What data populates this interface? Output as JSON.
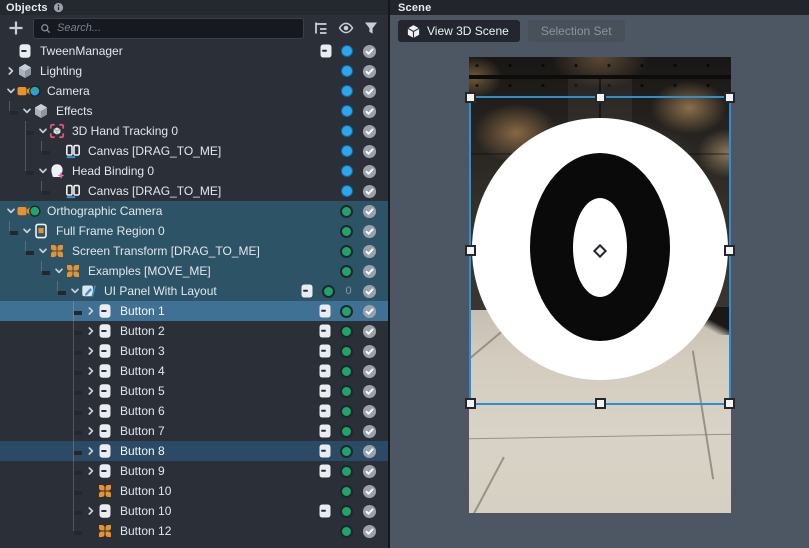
{
  "colors": {
    "panel_bg": "#2b2f37",
    "header_bg": "#24282f",
    "row_teal": "#2d5366",
    "row_selected": "#3e7194",
    "row_selected_alt": "#2a4a66",
    "dot_blue": "#2ba7f2",
    "dot_green": "#1fa469",
    "accent_orange": "#e8922e",
    "gizmo_blue": "#2f8ecf",
    "scene_bg": "#4d5663"
  },
  "objects_panel": {
    "title": "Objects",
    "search_placeholder": "Search...",
    "rows": [
      {
        "label": "TweenManager",
        "level": 0,
        "icon": "script-icon",
        "chevron": null,
        "script_badge": true,
        "dot": "blue",
        "count": null,
        "bg": "none",
        "lines": [],
        "elbow": null,
        "last": true
      },
      {
        "label": "Lighting",
        "level": 0,
        "icon": "lighting-icon",
        "chevron": "right",
        "script_badge": false,
        "dot": "blue",
        "count": null,
        "bg": "none",
        "lines": [],
        "elbow": null,
        "last": true
      },
      {
        "label": "Camera",
        "level": 0,
        "icon": "camera-blue-icon",
        "chevron": "down",
        "script_badge": false,
        "dot": "blue",
        "count": null,
        "bg": "none",
        "lines": [],
        "elbow": null,
        "last": true
      },
      {
        "label": "Effects",
        "level": 1,
        "icon": "effects-icon",
        "chevron": "down",
        "script_badge": false,
        "dot": "blue",
        "count": null,
        "bg": "none",
        "lines": [],
        "elbow": 0,
        "last": true
      },
      {
        "label": "3D Hand Tracking 0",
        "level": 2,
        "icon": "hand-tracking-icon",
        "chevron": "down",
        "script_badge": false,
        "dot": "blue",
        "count": null,
        "bg": "none",
        "lines": [],
        "elbow": 1,
        "last": false
      },
      {
        "label": "Canvas [DRAG_TO_ME]",
        "level": 3,
        "icon": "canvas-icon",
        "chevron": null,
        "script_badge": false,
        "dot": "blue",
        "count": null,
        "bg": "none",
        "lines": [
          1
        ],
        "elbow": 2,
        "last": true
      },
      {
        "label": "Head Binding 0",
        "level": 2,
        "icon": "head-binding-icon",
        "chevron": "down",
        "script_badge": false,
        "dot": "blue",
        "count": null,
        "bg": "none",
        "lines": [],
        "elbow": 1,
        "last": true
      },
      {
        "label": "Canvas [DRAG_TO_ME]",
        "level": 3,
        "icon": "canvas-icon",
        "chevron": null,
        "script_badge": false,
        "dot": "blue",
        "count": null,
        "bg": "none",
        "lines": [],
        "elbow": 2,
        "last": true
      },
      {
        "label": "Orthographic Camera",
        "level": 0,
        "icon": "camera-green-icon",
        "chevron": "down",
        "script_badge": false,
        "dot": "green",
        "count": null,
        "bg": "teal",
        "lines": [],
        "elbow": null,
        "last": true
      },
      {
        "label": "Full Frame Region 0",
        "level": 1,
        "icon": "frame-region-icon",
        "chevron": "down",
        "script_badge": false,
        "dot": "green",
        "count": null,
        "bg": "teal",
        "lines": [],
        "elbow": 0,
        "last": true
      },
      {
        "label": "Screen Transform [DRAG_TO_ME]",
        "level": 2,
        "icon": "screen-transform-icon",
        "chevron": "down",
        "script_badge": false,
        "dot": "green",
        "count": null,
        "bg": "teal",
        "lines": [],
        "elbow": 1,
        "last": true
      },
      {
        "label": "Examples [MOVE_ME]",
        "level": 3,
        "icon": "screen-transform-icon",
        "chevron": "down",
        "script_badge": false,
        "dot": "green",
        "count": null,
        "bg": "teal",
        "lines": [],
        "elbow": 2,
        "last": true
      },
      {
        "label": "UI Panel With Layout",
        "level": 4,
        "icon": "ui-panel-icon",
        "chevron": "down",
        "script_badge": true,
        "dot": "green",
        "count": "0",
        "bg": "teal",
        "lines": [],
        "elbow": 3,
        "last": true
      },
      {
        "label": "Button 1",
        "level": 5,
        "icon": "script-icon",
        "chevron": "right",
        "script_badge": true,
        "dot": "green",
        "count": null,
        "bg": "selected",
        "lines": [],
        "elbow": 4,
        "last": false
      },
      {
        "label": "Button 2",
        "level": 5,
        "icon": "script-icon",
        "chevron": "right",
        "script_badge": true,
        "dot": "green",
        "count": null,
        "bg": "none",
        "lines": [],
        "elbow": 4,
        "last": false
      },
      {
        "label": "Button 3",
        "level": 5,
        "icon": "script-icon",
        "chevron": "right",
        "script_badge": true,
        "dot": "green",
        "count": null,
        "bg": "none",
        "lines": [],
        "elbow": 4,
        "last": false
      },
      {
        "label": "Button 4",
        "level": 5,
        "icon": "script-icon",
        "chevron": "right",
        "script_badge": true,
        "dot": "green",
        "count": null,
        "bg": "none",
        "lines": [],
        "elbow": 4,
        "last": false
      },
      {
        "label": "Button 5",
        "level": 5,
        "icon": "script-icon",
        "chevron": "right",
        "script_badge": true,
        "dot": "green",
        "count": null,
        "bg": "none",
        "lines": [],
        "elbow": 4,
        "last": false
      },
      {
        "label": "Button 6",
        "level": 5,
        "icon": "script-icon",
        "chevron": "right",
        "script_badge": true,
        "dot": "green",
        "count": null,
        "bg": "none",
        "lines": [],
        "elbow": 4,
        "last": false
      },
      {
        "label": "Button 7",
        "level": 5,
        "icon": "script-icon",
        "chevron": "right",
        "script_badge": true,
        "dot": "green",
        "count": null,
        "bg": "none",
        "lines": [],
        "elbow": 4,
        "last": false
      },
      {
        "label": "Button 8",
        "level": 5,
        "icon": "script-icon",
        "chevron": "right",
        "script_badge": true,
        "dot": "green",
        "count": null,
        "bg": "selected-alt",
        "lines": [],
        "elbow": 4,
        "last": false
      },
      {
        "label": "Button 9",
        "level": 5,
        "icon": "script-icon",
        "chevron": "right",
        "script_badge": true,
        "dot": "green",
        "count": null,
        "bg": "none",
        "lines": [],
        "elbow": 4,
        "last": false
      },
      {
        "label": "Button 10",
        "level": 5,
        "icon": "screen-transform-icon",
        "chevron": null,
        "script_badge": false,
        "dot": "green",
        "count": null,
        "bg": "none",
        "lines": [],
        "elbow": 4,
        "last": false
      },
      {
        "label": "Button 10",
        "level": 5,
        "icon": "script-icon",
        "chevron": "right",
        "script_badge": true,
        "dot": "green",
        "count": null,
        "bg": "none",
        "lines": [],
        "elbow": 4,
        "last": false
      },
      {
        "label": "Button 12",
        "level": 5,
        "icon": "screen-transform-icon",
        "chevron": null,
        "script_badge": false,
        "dot": "green",
        "count": null,
        "bg": "none",
        "lines": [],
        "elbow": 4,
        "last": true
      }
    ]
  },
  "scene_panel": {
    "title": "Scene",
    "view_3d_button": "View 3D Scene",
    "selection_set_button": "Selection Set",
    "preview": {
      "digit": "0"
    }
  }
}
